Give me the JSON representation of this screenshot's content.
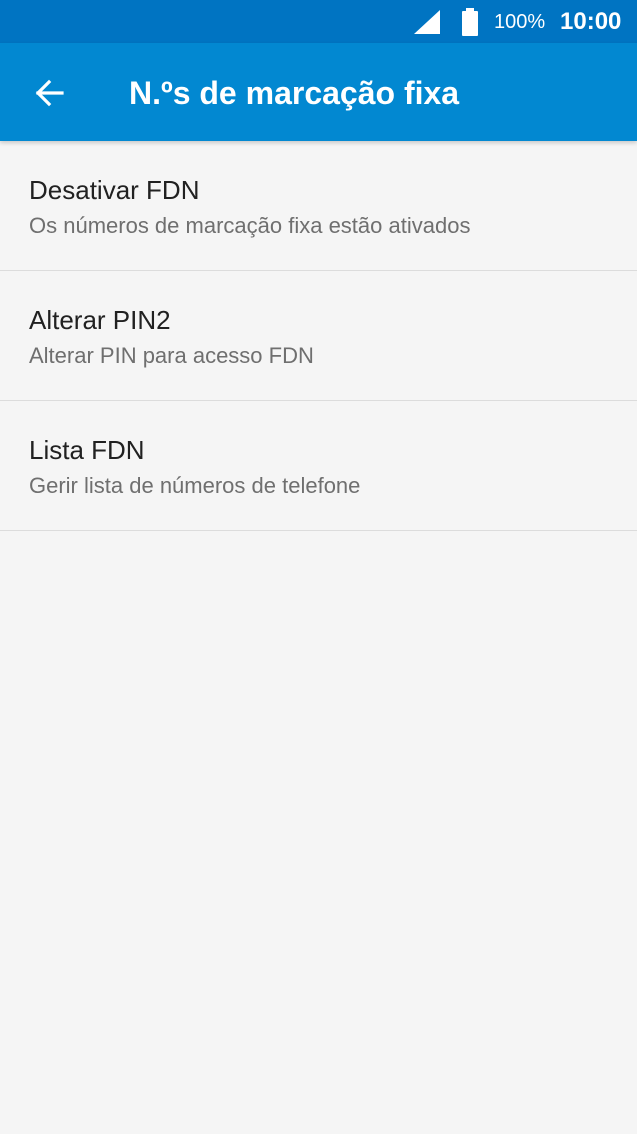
{
  "status_bar": {
    "battery_percent": "100%",
    "time": "10:00",
    "icons": [
      "signal-icon",
      "battery-icon"
    ]
  },
  "app_bar": {
    "title": "N.ºs de marcação fixa",
    "back_icon": "arrow-left-icon"
  },
  "colors": {
    "status_bar": "#0074c2",
    "app_bar": "#0288d1",
    "background": "#f5f5f5",
    "title_text": "#212121",
    "subtitle_text": "#6f6f6f",
    "divider": "#dcdcdc"
  },
  "settings": {
    "items": [
      {
        "title": "Desativar FDN",
        "subtitle": "Os números de marcação fixa estão ativados"
      },
      {
        "title": "Alterar PIN2",
        "subtitle": "Alterar PIN para acesso FDN"
      },
      {
        "title": "Lista FDN",
        "subtitle": "Gerir lista de números de telefone"
      }
    ]
  }
}
